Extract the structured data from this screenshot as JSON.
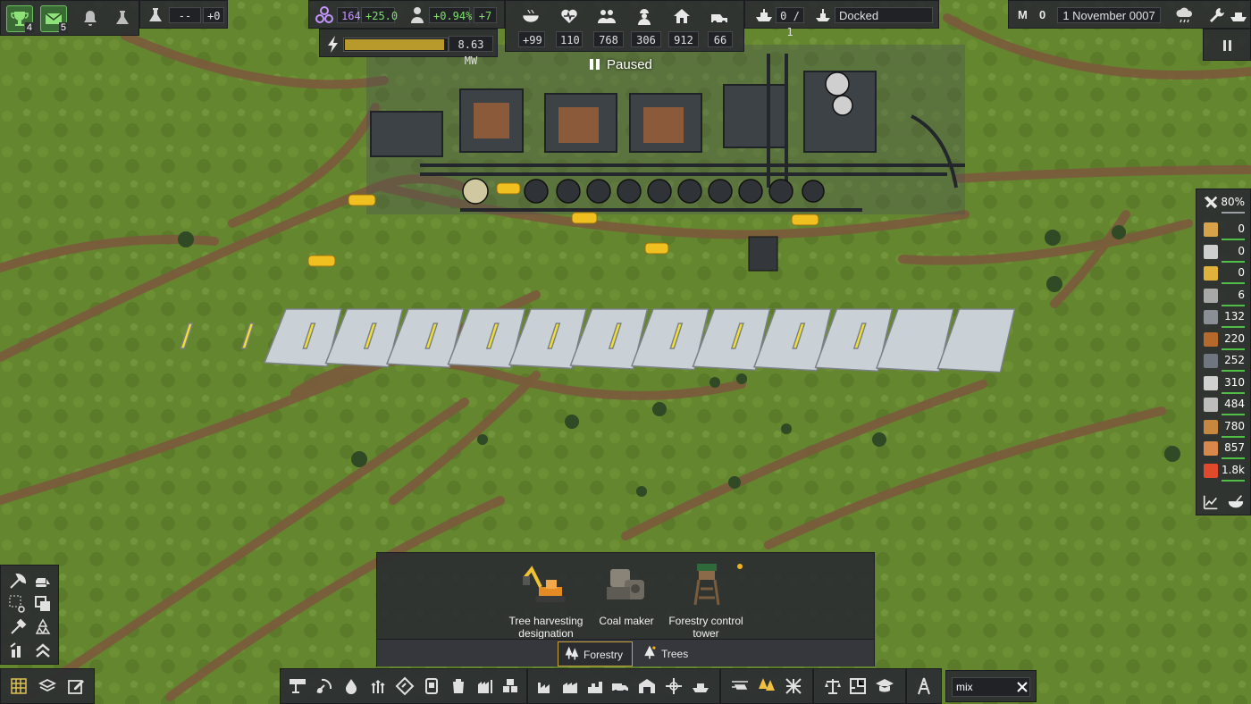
{
  "top_left": {
    "achievements_count": "4",
    "messages_count": "5",
    "research_value": "--",
    "research_delta": "+0"
  },
  "stats": {
    "unity": "164",
    "unity_delta": "+25.0",
    "population_growth": "+0.94%",
    "population_delta": "+7",
    "power": "8.63 MW",
    "power_fill": 0.97
  },
  "needs": {
    "food": "+99",
    "health": "110",
    "population": "768",
    "workers": "306",
    "housing": "912",
    "vehicles": "66"
  },
  "game_state": "Paused",
  "ship": {
    "ratio": "0 / 1",
    "status": "Docked"
  },
  "date_panel": {
    "currency_label": "M",
    "currency_value": "0",
    "date": "1 November 0007"
  },
  "resources": {
    "maintenance": "80%",
    "items": [
      {
        "icon": "food-crate-icon",
        "value": "0",
        "color": "#d7a24a"
      },
      {
        "icon": "worker-icon",
        "value": "0",
        "color": "#cfcfcf"
      },
      {
        "icon": "worker-gold-icon",
        "value": "0",
        "color": "#e0b23c"
      },
      {
        "icon": "iron-plate-icon",
        "value": "6",
        "color": "#a8a8a8"
      },
      {
        "icon": "scrap-icon",
        "value": "132",
        "color": "#8a8f96"
      },
      {
        "icon": "wood-logs-icon",
        "value": "220",
        "color": "#b56a2c"
      },
      {
        "icon": "steel-icon",
        "value": "252",
        "color": "#6f7680"
      },
      {
        "icon": "tools-icon",
        "value": "310",
        "color": "#d0d0d0"
      },
      {
        "icon": "concrete-icon",
        "value": "484",
        "color": "#bdbdbd"
      },
      {
        "icon": "wood-icon",
        "value": "780",
        "color": "#c7873f"
      },
      {
        "icon": "planks-icon",
        "value": "857",
        "color": "#d9874a"
      },
      {
        "icon": "fuel-icon",
        "value": "1.8k",
        "color": "#e04a2a"
      }
    ]
  },
  "build_menu": {
    "items": [
      {
        "label": "Tree harvesting designation"
      },
      {
        "label": "Coal maker"
      },
      {
        "label": "Forestry control tower"
      }
    ],
    "tabs": [
      {
        "label": "Forestry"
      },
      {
        "label": "Trees"
      }
    ]
  },
  "search": {
    "value": "mix"
  },
  "colors": {
    "panel": "#2c2e32",
    "accent_green": "#6cc05f",
    "accent_gold": "#c8a23c",
    "unity_purple": "#c596ff"
  }
}
